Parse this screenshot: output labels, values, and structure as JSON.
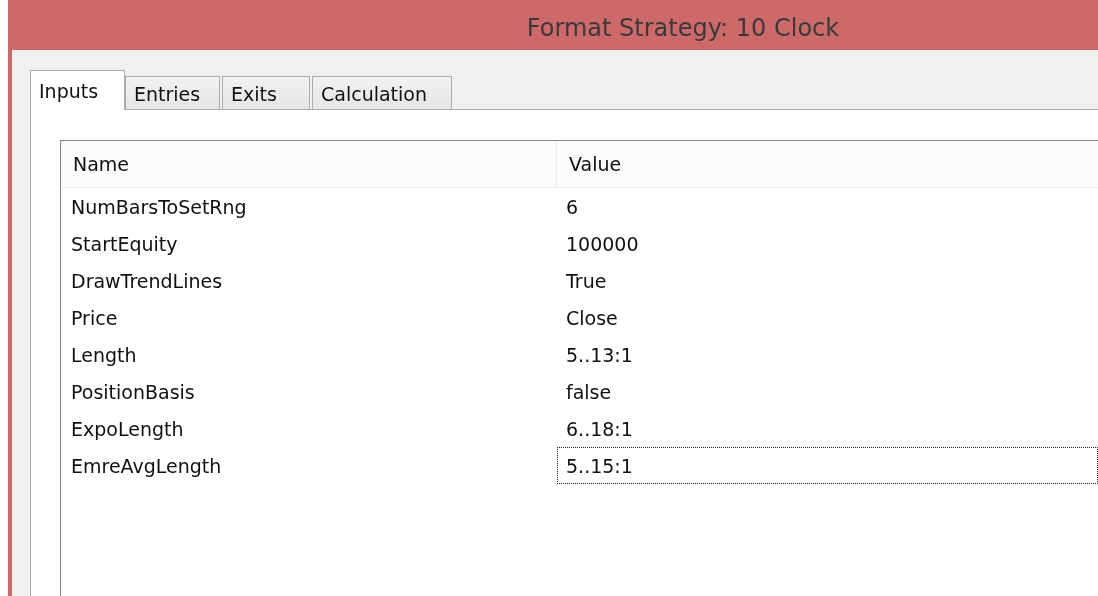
{
  "window": {
    "title": "Format Strategy: 10 Clock"
  },
  "tabs": [
    {
      "label": "Inputs",
      "selected": true
    },
    {
      "label": "Entries",
      "selected": false
    },
    {
      "label": "Exits",
      "selected": false
    },
    {
      "label": "Calculation",
      "selected": false
    }
  ],
  "table": {
    "columns": [
      "Name",
      "Value"
    ],
    "rows": [
      {
        "name": "NumBarsToSetRng",
        "value": "6",
        "focused": false
      },
      {
        "name": "StartEquity",
        "value": "100000",
        "focused": false
      },
      {
        "name": "DrawTrendLines",
        "value": "True",
        "focused": false
      },
      {
        "name": "Price",
        "value": "Close",
        "focused": false
      },
      {
        "name": "Length",
        "value": "5..13:1",
        "focused": false
      },
      {
        "name": "PositionBasis",
        "value": "false",
        "focused": false
      },
      {
        "name": "ExpoLength",
        "value": "6..18:1",
        "focused": false
      },
      {
        "name": "EmreAvgLength",
        "value": "5..15:1",
        "focused": true
      }
    ]
  }
}
